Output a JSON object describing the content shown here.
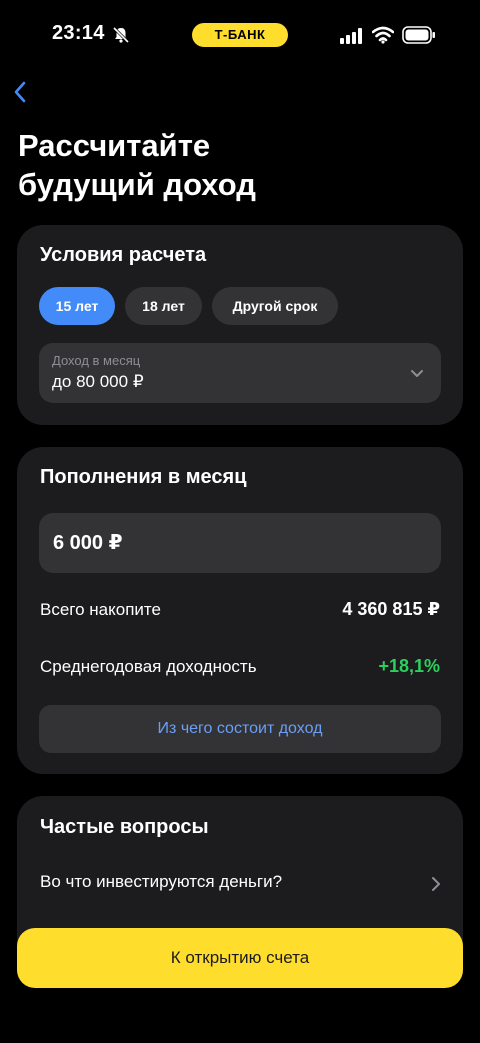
{
  "status_bar": {
    "time": "23:14",
    "bank_label": "Т-БАНК"
  },
  "page": {
    "title_line1": "Рассчитайте",
    "title_line2": "будущий доход"
  },
  "conditions": {
    "title": "Условия расчета",
    "chips": [
      {
        "label": "15 лет",
        "active": true
      },
      {
        "label": "18 лет",
        "active": false
      },
      {
        "label": "Другой срок",
        "active": false
      }
    ],
    "income_select": {
      "label": "Доход в месяц",
      "value": "до 80 000 ₽"
    }
  },
  "topup": {
    "title": "Пополнения в месяц",
    "amount": "6 000 ₽",
    "total_label": "Всего накопите",
    "total_value": "4 360 815 ₽",
    "yield_label": "Среднегодовая доходность",
    "yield_value": "+18,1%",
    "breakdown_link": "Из чего состоит доход"
  },
  "faq": {
    "title": "Частые вопросы",
    "items": [
      {
        "label": "Во что инвестируются деньги?"
      }
    ]
  },
  "cta": {
    "label": "К открытию счета"
  },
  "colors": {
    "accent_yellow": "#ffdd2d",
    "chip_active": "#428bf9",
    "positive_green": "#2bd05e",
    "link_blue": "#6a9ff6",
    "card_bg": "#1c1c1e"
  },
  "icons": [
    "bell-slash-icon",
    "signal-icon",
    "wifi-icon",
    "battery-icon",
    "back-chevron-icon",
    "chevron-down-icon",
    "chevron-right-icon"
  ]
}
